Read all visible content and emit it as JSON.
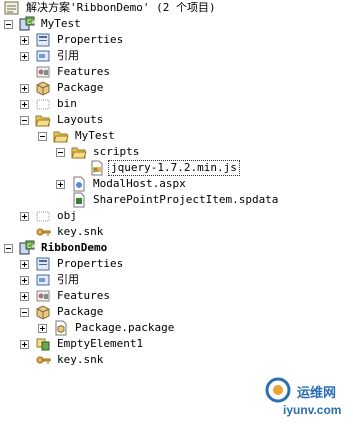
{
  "solution": {
    "label": "解决方案'RibbonDemo' (2 个项目)",
    "icon": "solution-icon"
  },
  "tree": [
    {
      "label": "MyTest",
      "icon": "project-icon",
      "expander": "minus",
      "bold": false
    },
    {
      "label": "Properties",
      "icon": "properties-icon",
      "expander": "plus"
    },
    {
      "label": "引用",
      "icon": "references-icon",
      "expander": "plus"
    },
    {
      "label": "Features",
      "icon": "features-icon",
      "expander": "none"
    },
    {
      "label": "Package",
      "icon": "package-icon",
      "expander": "plus"
    },
    {
      "label": "bin",
      "icon": "folder-dotted-icon",
      "expander": "plus"
    },
    {
      "label": "Layouts",
      "icon": "folder-open-icon",
      "expander": "minus"
    },
    {
      "label": "MyTest",
      "icon": "folder-open-icon",
      "expander": "minus"
    },
    {
      "label": "scripts",
      "icon": "folder-open-icon",
      "expander": "minus"
    },
    {
      "label": "jquery-1.7.2.min.js",
      "icon": "js-file-icon",
      "expander": "none",
      "selected": true
    },
    {
      "label": "ModalHost.aspx",
      "icon": "aspx-file-icon",
      "expander": "plus"
    },
    {
      "label": "SharePointProjectItem.spdata",
      "icon": "spdata-file-icon",
      "expander": "none"
    },
    {
      "label": "obj",
      "icon": "folder-dotted-icon",
      "expander": "plus"
    },
    {
      "label": "key.snk",
      "icon": "key-icon",
      "expander": "none"
    },
    {
      "label": "RibbonDemo",
      "icon": "project-icon",
      "expander": "minus",
      "bold": true
    },
    {
      "label": "Properties",
      "icon": "properties-icon",
      "expander": "plus"
    },
    {
      "label": "引用",
      "icon": "references-icon",
      "expander": "plus"
    },
    {
      "label": "Features",
      "icon": "features-icon",
      "expander": "plus"
    },
    {
      "label": "Package",
      "icon": "package-icon",
      "expander": "minus"
    },
    {
      "label": "Package.package",
      "icon": "package-file-icon",
      "expander": "plus"
    },
    {
      "label": "EmptyElement1",
      "icon": "element-icon",
      "expander": "plus"
    },
    {
      "label": "key.snk",
      "icon": "key-icon",
      "expander": "none"
    }
  ],
  "watermark": {
    "text": "运维网",
    "url": "iyunv.com"
  },
  "colors": {
    "folder": "#e8c35a",
    "accent": "#2a6fb1"
  }
}
